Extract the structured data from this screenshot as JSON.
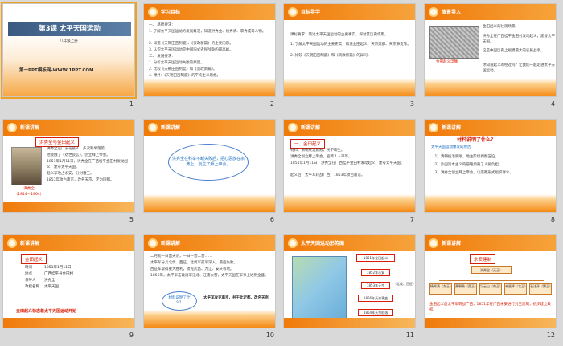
{
  "slides": [
    {
      "number": "1",
      "header": "",
      "title": "第3课 太平天国运动",
      "subtitle": "八年级上册",
      "link": "第一PPT模板网-WWW.1PPT.COM"
    },
    {
      "number": "2",
      "header": "学习目标",
      "lines": [
        "一、 基础要求：",
        "1. 了解太平天国运动的发展概况，知道洪秀全、杨秀清、李秀成等人物。",
        "2. 知道《天朝田亩制度》、《资政新篇》的主要内容。",
        "3. 认识太平天国运动是中国旧式农民战争的最高峰。",
        "二、 发展要求：",
        "1. 分析太平天国运动失败的原因。",
        "2. 比较《天朝田亩制度》和《资政新篇》。",
        "4. 课外：《天朝田亩制度》的平均主义思想。"
      ]
    },
    {
      "number": "3",
      "header": "目标导学",
      "lines": [
        "课标要求：简述太平天国运动的主要事实，探讨其历史作用。",
        "1. 了解太平天国运动的主要史实，知道金田起义、天京建都、天京事变等。",
        "2. 比较《天朝田亩制度》和《资政新篇》的异同。"
      ]
    },
    {
      "number": "4",
      "header": "情景导入",
      "lines": [
        "金田起义的壮观场景。",
        "洪秀全在广西桂平金田村发动起义，建号太平天国。",
        "这是中国历史上规模最大的农民战争。",
        "你知道起义的经过吗？让我们一起走进太平天国运动。"
      ],
      "caption": "金田起义浮雕"
    },
    {
      "number": "5",
      "header": "新课讲解",
      "tag": "洪秀全与金田起义",
      "lines": [
        "洪秀全是广东花县人，多次科举落第。",
        "他接触了《劝世良言》，创立拜上帝会。",
        "1851年1月11日，洪秀全在广西桂平金田村发动起义，建号太平天国。",
        "起义军攻占永安，分封诸王。",
        "1853年攻占南京，改名天京，定为国都。"
      ],
      "caption": "洪秀全\n（1814－1864）"
    },
    {
      "number": "6",
      "header": "新课讲解",
      "bubble": "洪秀全在科举不断失败后，把心思放在宗教上，创立了拜上帝会。"
    },
    {
      "number": "7",
      "header": "新课讲解",
      "tag": "一、金田起义",
      "lines": [
        "材料：清朝统治腐败，民不聊生。",
        "洪秀全创立拜上帝会，宣传人人平等。",
        "1851年1月11日，洪秀全在广西桂平金田村发动起义，建号太平天国。",
        "起义后，太平军转战广西，1853年攻占南京。"
      ]
    },
    {
      "number": "8",
      "header": "新课讲解",
      "question": "材料说明了什么？",
      "sub": "太平天国运动爆发的原因",
      "lines": [
        "（1）清朝统治腐败，地主阶级剥削压迫。",
        "（2）外国资本主义的侵略加重了人民负担。",
        "（3）洪秀全创立拜上帝会，以宗教形式组织群众。"
      ]
    },
    {
      "number": "9",
      "header": "新课讲解",
      "tag": "金田起义",
      "rows": [
        [
          "时间",
          "1851年1月11日"
        ],
        [
          "地点",
          "广西桂平县金田村"
        ],
        [
          "领导人",
          "洪秀全"
        ],
        [
          "政权名称",
          "太平天国"
        ]
      ],
      "footer": "金田起义标志着太平天国运动开始"
    },
    {
      "number": "10",
      "header": "新课讲解",
      "lines": [
        "二月初一日出天京，一日一营二营……",
        "太平军分兵北伐、西征，北伐军孤军深入，最后失败。",
        "西征军取得重大胜利，攻克武昌、九江、安庆等地。",
        "1856年，太平军击破清军江北、江南大营，太平天国在军事上达到全盛。"
      ],
      "bubble": "材料说明了什么？",
      "note": "太平军攻克南京，并于此定都，改名天京"
    },
    {
      "number": "11",
      "header": "太平天国运动形势图",
      "flow": [
        "1851年金田起义",
        "1852年永安",
        "1853年天京",
        "1856年天京事变",
        "1864年天京陷落"
      ],
      "legend": "（北伐、西征）"
    },
    {
      "number": "12",
      "header": "新课讲解",
      "title": "永安建制",
      "top": "洪秀全（天王）",
      "children": [
        "杨秀清（东王）",
        "萧朝贵（西王）",
        "冯云山（南王）",
        "韦昌辉（北王）",
        "石达开（翼王）"
      ],
      "note": "金田起义后太平军转战广西，1851年在广西永安进行封王建制，初步建立政权。"
    }
  ]
}
